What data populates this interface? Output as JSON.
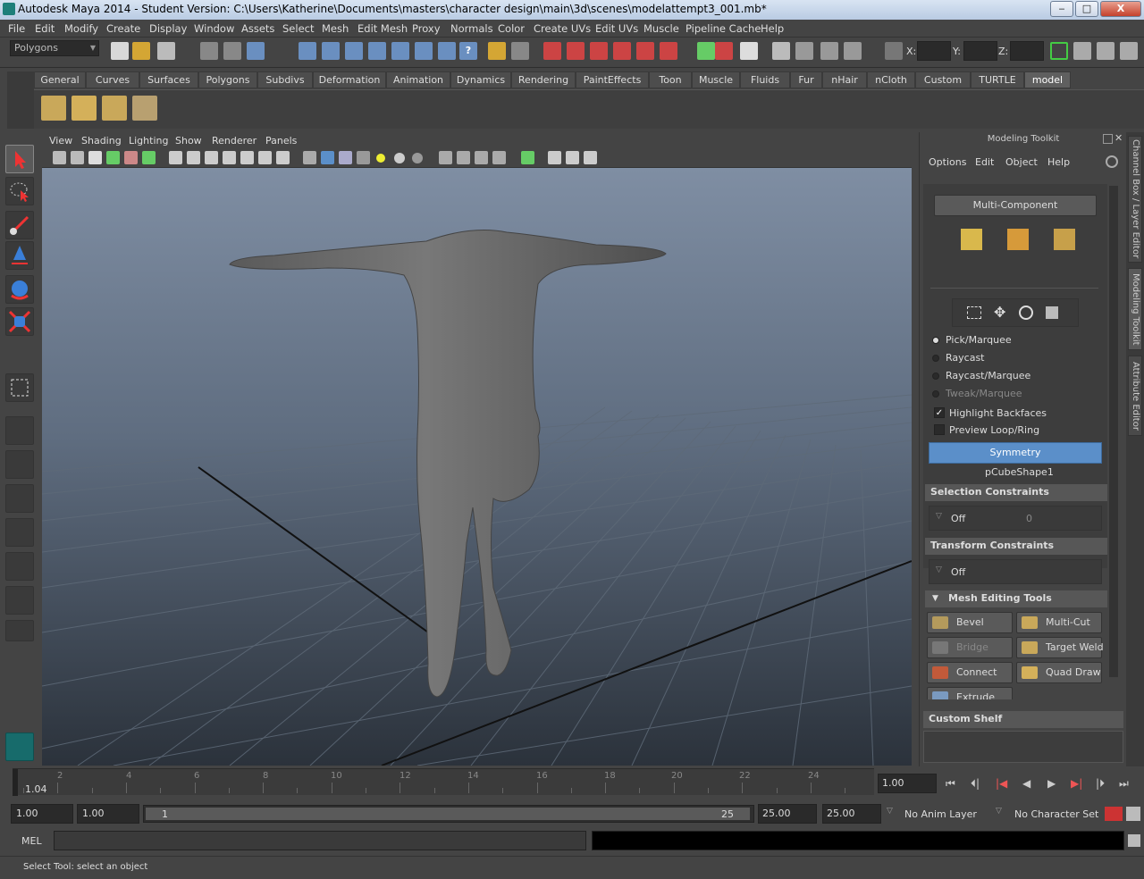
{
  "window": {
    "title": "Autodesk Maya 2014 - Student Version: C:\\Users\\Katherine\\Documents\\masters\\character design\\main\\3d\\scenes\\modelattempt3_001.mb*",
    "minimize": "‒",
    "maximize": "□",
    "close": "X"
  },
  "menubar": [
    "File",
    "Edit",
    "Modify",
    "Create",
    "Display",
    "Window",
    "Assets",
    "Select",
    "Mesh",
    "Edit Mesh",
    "Proxy",
    "Normals",
    "Color",
    "Create UVs",
    "Edit UVs",
    "Muscle",
    "Pipeline Cache",
    "Help"
  ],
  "statusline": {
    "mode": "Polygons",
    "x_label": "X:",
    "y_label": "Y:",
    "z_label": "Z:"
  },
  "shelf": {
    "tabs": [
      "General",
      "Curves",
      "Surfaces",
      "Polygons",
      "Subdivs",
      "Deformation",
      "Animation",
      "Dynamics",
      "Rendering",
      "PaintEffects",
      "Toon",
      "Muscle",
      "Fluids",
      "Fur",
      "nHair",
      "nCloth",
      "Custom",
      "TURTLE",
      "model"
    ],
    "active_tab": "model"
  },
  "panel": {
    "menus": [
      "View",
      "Shading",
      "Lighting",
      "Show",
      "Renderer",
      "Panels"
    ]
  },
  "toolkit": {
    "title": "Modeling Toolkit",
    "menus": [
      "Options",
      "Edit",
      "Object",
      "Help"
    ],
    "multi_component": "Multi-Component",
    "pick_modes": [
      {
        "label": "Pick/Marquee",
        "selected": true,
        "dim": false
      },
      {
        "label": "Raycast",
        "selected": false,
        "dim": false
      },
      {
        "label": "Raycast/Marquee",
        "selected": false,
        "dim": false
      },
      {
        "label": "Tweak/Marquee",
        "selected": false,
        "dim": true
      }
    ],
    "highlight_backfaces": "Highlight Backfaces",
    "preview_loop": "Preview Loop/Ring",
    "symmetry": "Symmetry",
    "object_name": "pCubeShape1",
    "selection_constraints": "Selection Constraints",
    "sel_constraint_value": "Off",
    "sel_constraint_num": "0",
    "transform_constraints": "Transform Constraints",
    "xform_constraint_value": "Off",
    "mesh_editing_tools": "Mesh Editing Tools",
    "tools": [
      {
        "label": "Bevel",
        "dim": false
      },
      {
        "label": "Multi-Cut",
        "dim": false
      },
      {
        "label": "Bridge",
        "dim": true
      },
      {
        "label": "Target Weld",
        "dim": false
      },
      {
        "label": "Connect",
        "dim": false
      },
      {
        "label": "Quad Draw",
        "dim": false
      },
      {
        "label": "Extrude",
        "dim": false
      }
    ],
    "custom_shelf": "Custom Shelf"
  },
  "sidetabs": [
    "Channel Box / Layer Editor",
    "Modeling Toolkit",
    "Attribute Editor"
  ],
  "timeline": {
    "current_frame": "1.04",
    "ticks": [
      "2",
      "4",
      "6",
      "8",
      "10",
      "12",
      "14",
      "16",
      "18",
      "20",
      "22",
      "24"
    ],
    "frame_field": "1.00"
  },
  "range": {
    "start": "1.00",
    "start2": "1.00",
    "range_start": "1",
    "range_end": "25",
    "end": "25.00",
    "end2": "25.00",
    "anim_layer": "No Anim Layer",
    "character_set": "No Character Set"
  },
  "cmdline": {
    "label": "MEL"
  },
  "helpline": {
    "text": "Select Tool: select an object"
  },
  "colors": {
    "accent_blue": "#5b8fc9",
    "viewport_top": "#7f8ea3",
    "viewport_bottom": "#2b323b"
  }
}
